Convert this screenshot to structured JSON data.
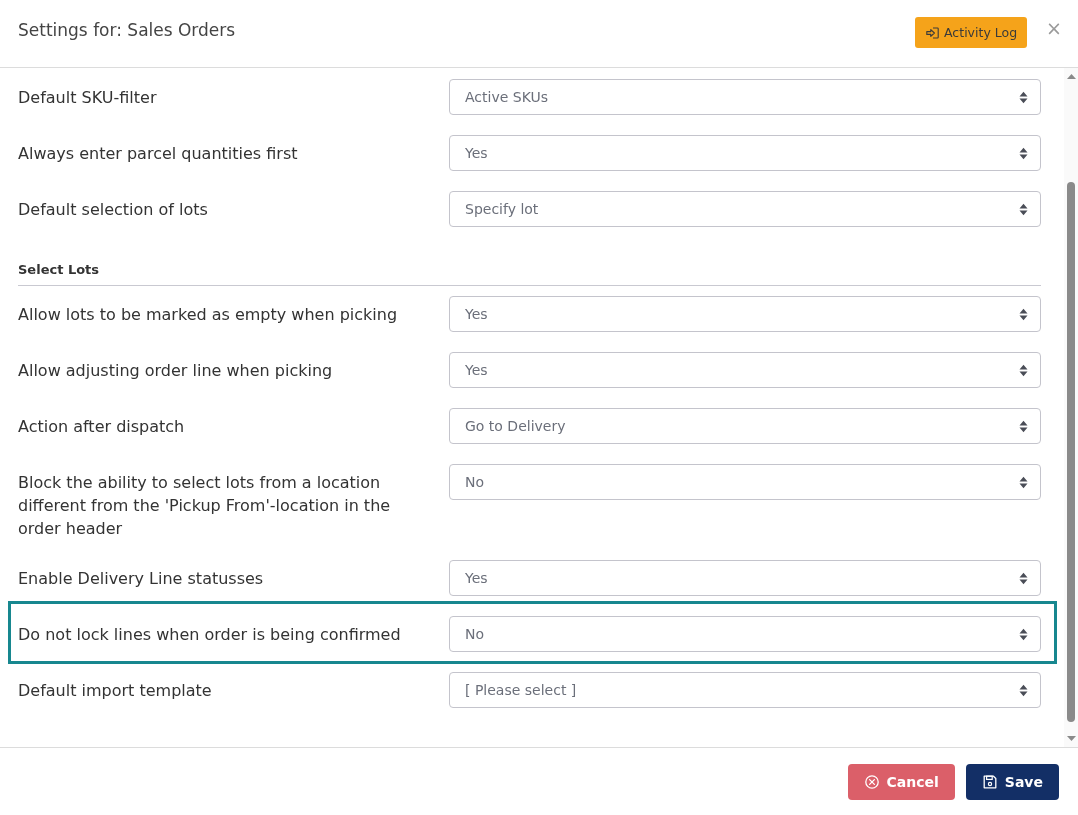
{
  "dialog": {
    "title": "Settings for: Sales Orders",
    "activity_log_button": "Activity Log",
    "close_button": "×"
  },
  "settings": [
    {
      "kind": "select",
      "label": "Default SKU-filter",
      "value": "Active SKUs",
      "highlighted": false
    },
    {
      "kind": "select",
      "label": "Always enter parcel quantities first",
      "value": "Yes",
      "highlighted": false
    },
    {
      "kind": "select",
      "label": "Default selection of lots",
      "value": "Specify lot",
      "highlighted": false
    },
    {
      "kind": "section",
      "label": "Select Lots"
    },
    {
      "kind": "select",
      "label": "Allow lots to be marked as empty when picking",
      "value": "Yes",
      "highlighted": false
    },
    {
      "kind": "select",
      "label": "Allow adjusting order line when picking",
      "value": "Yes",
      "highlighted": false
    },
    {
      "kind": "select",
      "label": "Action after dispatch",
      "value": "Go to Delivery",
      "highlighted": false
    },
    {
      "kind": "select",
      "label": "Block the ability to select lots from a location different from the 'Pickup From'-location in the order header",
      "value": "No",
      "highlighted": false
    },
    {
      "kind": "select",
      "label": "Enable Delivery Line statusses",
      "value": "Yes",
      "highlighted": false
    },
    {
      "kind": "select",
      "label": "Do not lock lines when order is being confirmed",
      "value": "No",
      "highlighted": true
    },
    {
      "kind": "select",
      "label": "Default import template",
      "value": "[ Please select ]",
      "highlighted": false
    }
  ],
  "footer": {
    "buttons": [
      {
        "kind": "cancel",
        "label": "Cancel"
      },
      {
        "kind": "save",
        "label": "Save"
      }
    ]
  }
}
